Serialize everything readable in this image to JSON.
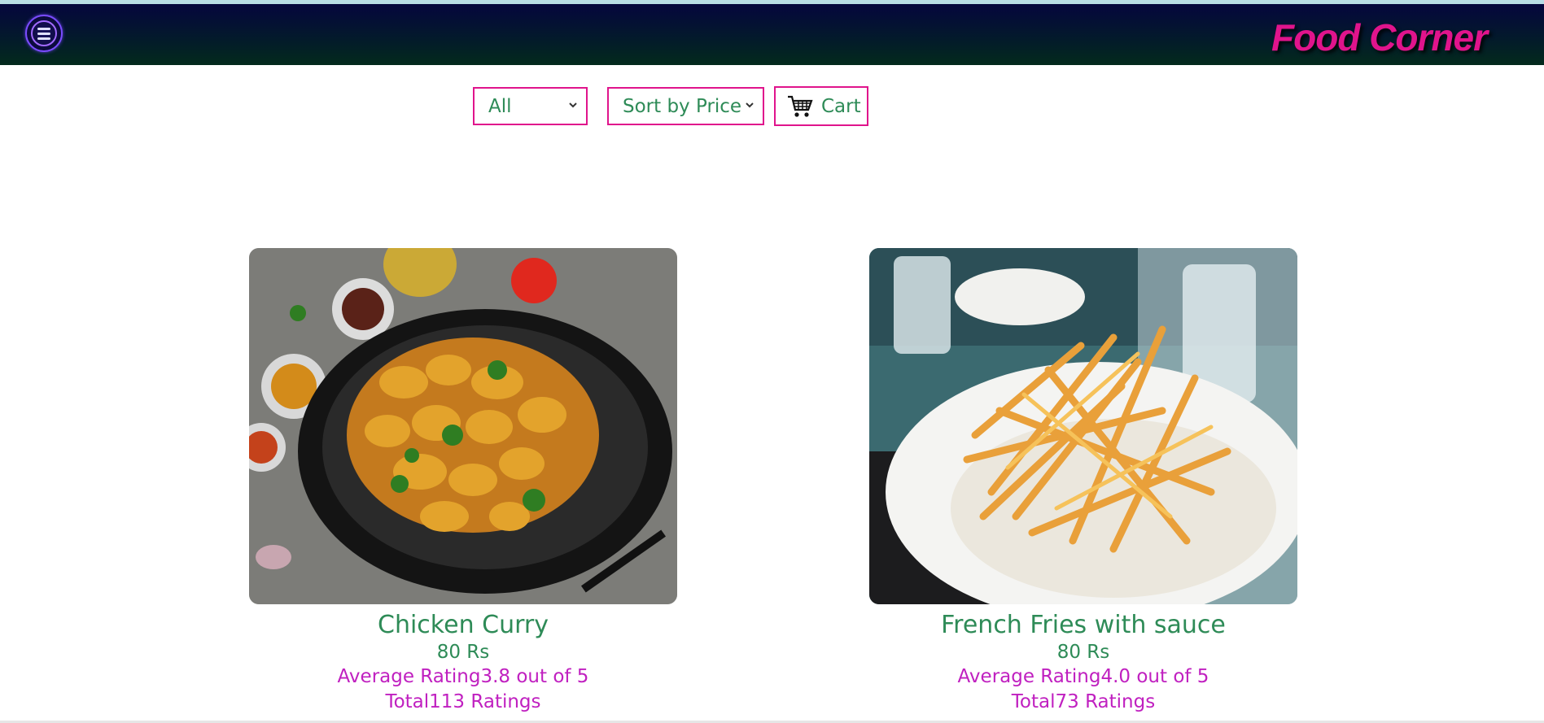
{
  "header": {
    "brand": "Food Corner",
    "menu_icon": "hamburger-menu-icon"
  },
  "filters": {
    "category": {
      "selected": "All"
    },
    "sort": {
      "selected": "Sort by Price"
    },
    "cart": {
      "label": "Cart",
      "icon": "shopping-cart-icon"
    }
  },
  "items": [
    {
      "name": "Chicken Curry",
      "price": "80 Rs",
      "rating_text": "Average Rating3.8   out of 5",
      "total_text": "Total113   Ratings",
      "image": "chicken-curry-photo"
    },
    {
      "name": "French Fries with sauce",
      "price": "80 Rs",
      "rating_text": "Average Rating4.0   out of 5",
      "total_text": "Total73   Ratings",
      "image": "french-fries-photo"
    }
  ],
  "colors": {
    "accent": "#e0148c",
    "text_green": "#2e8b57",
    "rating_purple": "#c020c0",
    "nav_dark": "#05063d"
  }
}
